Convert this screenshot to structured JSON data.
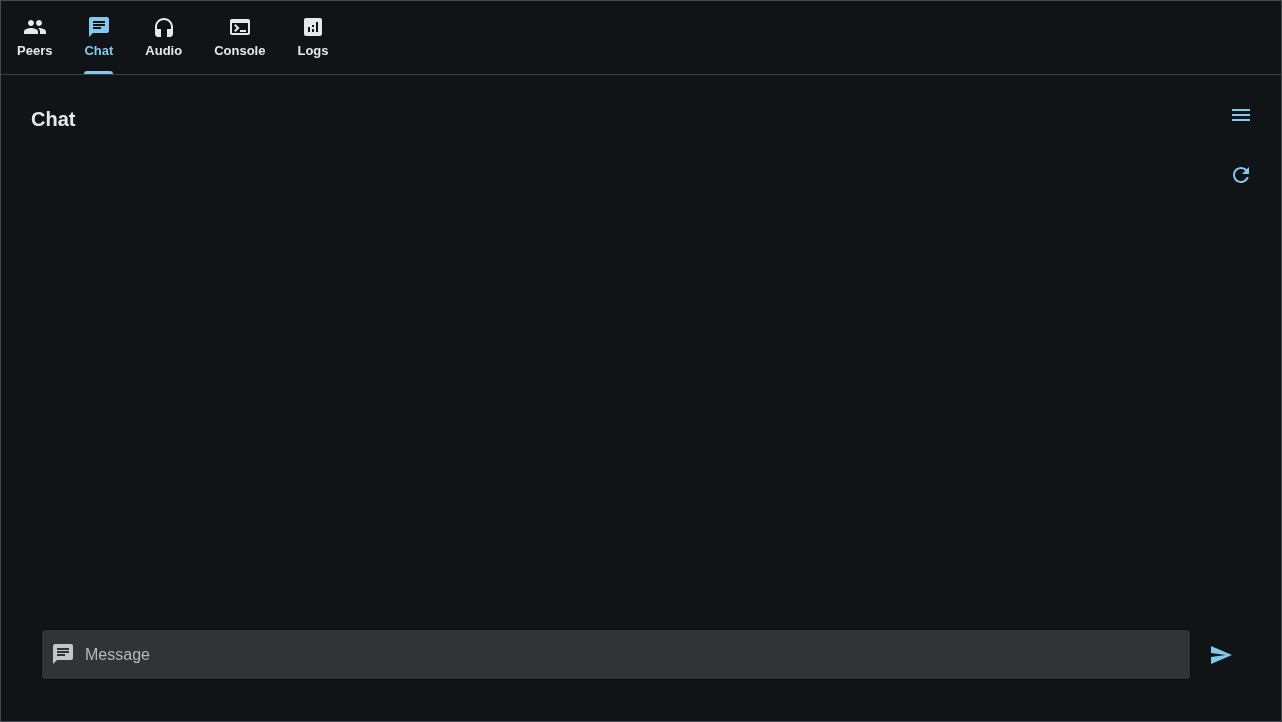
{
  "tabs": [
    {
      "label": "Peers",
      "selected": false
    },
    {
      "label": "Chat",
      "selected": true
    },
    {
      "label": "Audio",
      "selected": false
    },
    {
      "label": "Console",
      "selected": false
    },
    {
      "label": "Logs",
      "selected": false
    }
  ],
  "page": {
    "title": "Chat"
  },
  "message_field": {
    "placeholder": "Message"
  }
}
